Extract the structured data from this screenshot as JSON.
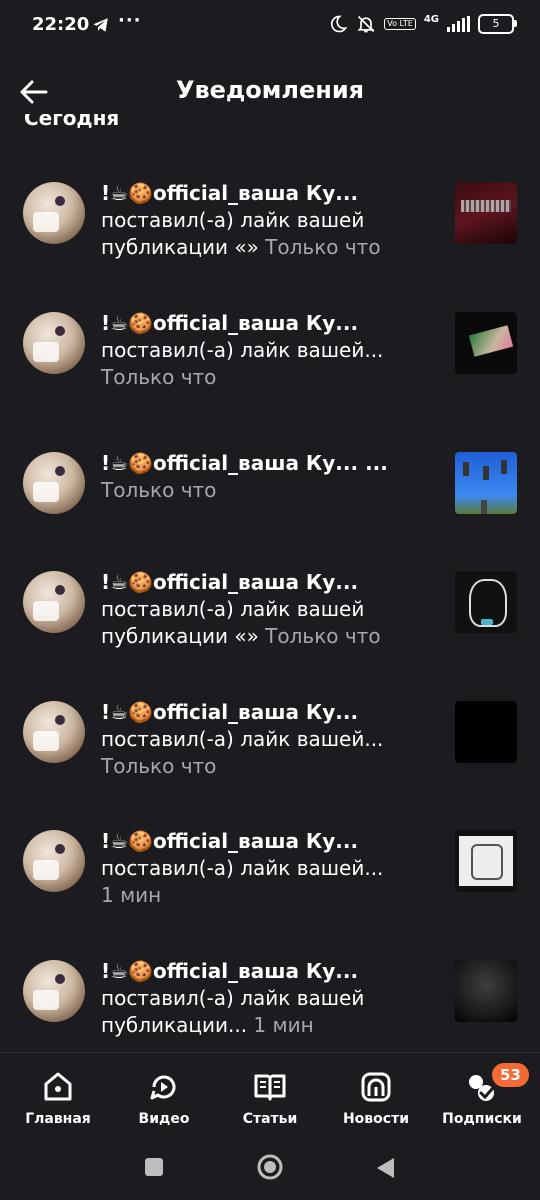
{
  "status_bar": {
    "time": "22:20",
    "more": "···",
    "volte": "Vo LTE",
    "network": "4G",
    "battery": "5"
  },
  "header": {
    "title": "Уведомления"
  },
  "section": {
    "label": "Сегодня"
  },
  "notifications": [
    {
      "name": "!☕🍪official_ваша Ку...",
      "body": "поставил(-а) лайк вашей публикации «»",
      "time": "Только что"
    },
    {
      "name": "!☕🍪official_ваша Ку...",
      "body": "поставил(-а) лайк вашей...",
      "time": "Только что"
    },
    {
      "name": "!☕🍪official_ваша Ку...",
      "body": "...",
      "time": "Только что"
    },
    {
      "name": "!☕🍪official_ваша Ку...",
      "body": "поставил(-а) лайк вашей публикации «»",
      "time": "Только что"
    },
    {
      "name": "!☕🍪official_ваша Ку...",
      "body": "поставил(-а) лайк вашей...",
      "time": "Только что"
    },
    {
      "name": "!☕🍪official_ваша Ку...",
      "body": "поставил(-а) лайк вашей...",
      "time": "1 мин"
    },
    {
      "name": "!☕🍪official_ваша Ку...",
      "body": "поставил(-а) лайк вашей публикации...",
      "time": "1 мин"
    }
  ],
  "nav": {
    "home": "Главная",
    "video": "Видео",
    "articles": "Статьи",
    "news": "Новости",
    "subscriptions": "Подписки",
    "subscriptions_badge": "53"
  },
  "colors": {
    "background": "#1c1b1f",
    "secondary_text": "#a7a7ad",
    "badge": "#f46a35"
  }
}
